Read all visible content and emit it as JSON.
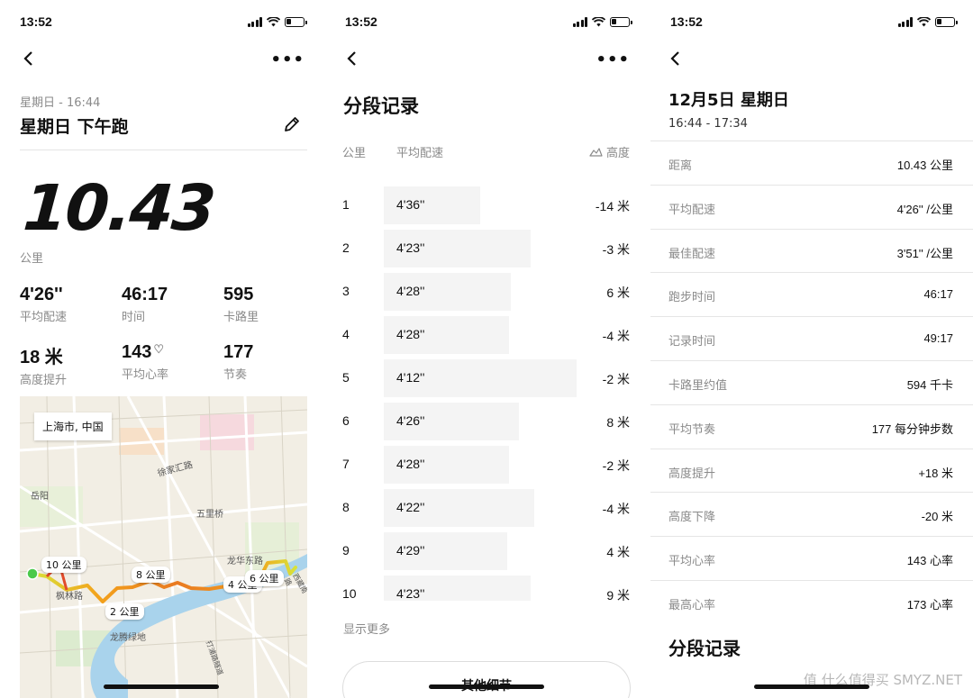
{
  "status": {
    "time": "13:52"
  },
  "panel1": {
    "subtitle": "星期日 - 16:44",
    "title": "星期日 下午跑",
    "distance": "10.43",
    "distance_unit": "公里",
    "stats": [
      {
        "value": "4'26''",
        "label": "平均配速"
      },
      {
        "value": "46:17",
        "label": "时间"
      },
      {
        "value": "595",
        "label": "卡路里"
      },
      {
        "value": "18 米",
        "label": "高度提升"
      },
      {
        "value": "143",
        "label": "平均心率"
      },
      {
        "value": "177",
        "label": "节奏"
      }
    ],
    "map": {
      "location": "上海市, 中国",
      "km_markers": [
        "10 公里",
        "8 公里",
        "4 公里",
        "2 公里",
        "6 公里"
      ],
      "places": [
        "岳阳",
        "五里桥",
        "枫林路",
        "龙腾绿地",
        "徐家汇路",
        "龙华东路",
        "西藏南路",
        "打浦路隧道"
      ]
    }
  },
  "panel2": {
    "title": "分段记录",
    "col_km": "公里",
    "col_pace": "平均配速",
    "col_elev": "高度",
    "splits": [
      {
        "km": "1",
        "pace": "4'36''",
        "elev": "-14 米",
        "pace_fraction": 0.5
      },
      {
        "km": "2",
        "pace": "4'23''",
        "elev": "-3 米",
        "pace_fraction": 0.76
      },
      {
        "km": "3",
        "pace": "4'28''",
        "elev": "6 米",
        "pace_fraction": 0.66
      },
      {
        "km": "4",
        "pace": "4'28''",
        "elev": "-4 米",
        "pace_fraction": 0.65
      },
      {
        "km": "5",
        "pace": "4'12''",
        "elev": "-2 米",
        "pace_fraction": 1.0
      },
      {
        "km": "6",
        "pace": "4'26''",
        "elev": "8 米",
        "pace_fraction": 0.7
      },
      {
        "km": "7",
        "pace": "4'28''",
        "elev": "-2 米",
        "pace_fraction": 0.65
      },
      {
        "km": "8",
        "pace": "4'22''",
        "elev": "-4 米",
        "pace_fraction": 0.78
      },
      {
        "km": "9",
        "pace": "4'29''",
        "elev": "4 米",
        "pace_fraction": 0.64
      },
      {
        "km": "10",
        "pace": "4'23''",
        "elev": "9 米",
        "pace_fraction": 0.76
      }
    ],
    "show_more": "显示更多",
    "other_details": "其他细节"
  },
  "panel3": {
    "date": "12月5日 星期日",
    "time_range": "16:44 - 17:34",
    "details": [
      {
        "key": "距离",
        "value": "10.43 公里"
      },
      {
        "key": "平均配速",
        "value": "4'26'' /公里"
      },
      {
        "key": "最佳配速",
        "value": "3'51'' /公里"
      },
      {
        "key": "跑步时间",
        "value": "46:17"
      },
      {
        "key": "记录时间",
        "value": "49:17"
      },
      {
        "key": "卡路里约值",
        "value": "594 千卡"
      },
      {
        "key": "平均节奏",
        "value": "177 每分钟步数"
      },
      {
        "key": "高度提升",
        "value": "+18 米"
      },
      {
        "key": "高度下降",
        "value": "-20 米"
      },
      {
        "key": "平均心率",
        "value": "143 心率"
      },
      {
        "key": "最高心率",
        "value": "173 心率"
      }
    ],
    "section_title": "分段记录"
  },
  "watermark": "值 什么值得买 SMYZ.NET",
  "colors": {
    "route_start": "#e24a2a",
    "route_mid": "#f3a21b",
    "route_end": "#d8e23a",
    "start_dot": "#4bc94b",
    "river": "#a9d3ec"
  }
}
